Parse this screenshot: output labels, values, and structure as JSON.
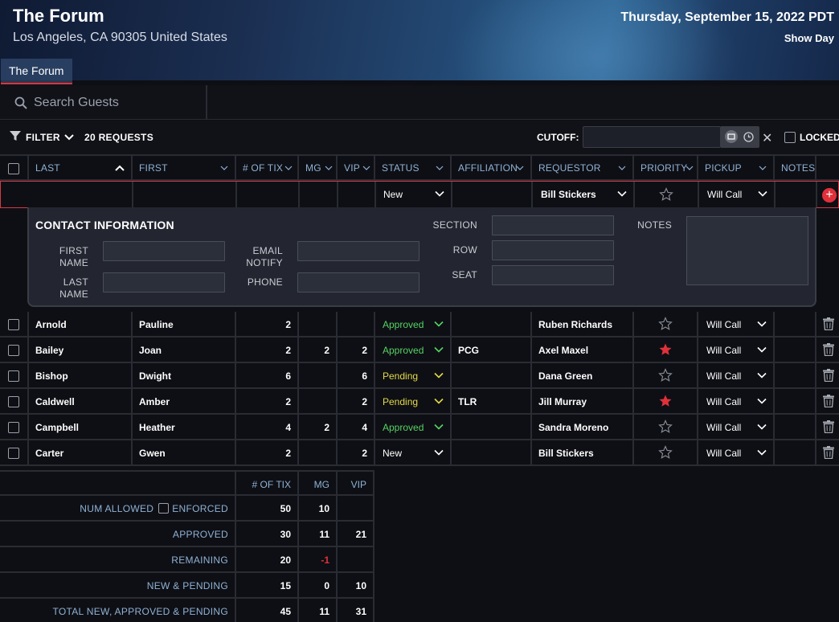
{
  "venue": {
    "title": "The Forum",
    "address": "Los Angeles, CA 90305 United States"
  },
  "show": {
    "date": "Thursday, September 15, 2022 PDT",
    "day": "Show Day"
  },
  "tabs": [
    {
      "label": "The Forum"
    }
  ],
  "search": {
    "placeholder": "Search Guests"
  },
  "filter": {
    "label": "FILTER",
    "count_label": "20 REQUESTS",
    "cutoff_label": "CUTOFF:",
    "locked_label": "LOCKED"
  },
  "columns": [
    "LAST",
    "FIRST",
    "# OF TIX",
    "MG",
    "VIP",
    "STATUS",
    "AFFILIATION",
    "REQUESTOR",
    "PRIORITY",
    "PICKUP",
    "NOTES"
  ],
  "new_row": {
    "status": "New",
    "requestor": "Bill Stickers",
    "pickup": "Will Call"
  },
  "contact": {
    "title": "CONTACT INFORMATION",
    "first_name_l1": "FIRST",
    "first_name_l2": "NAME",
    "last_name_l1": "LAST",
    "last_name_l2": "NAME",
    "email_l1": "EMAIL",
    "email_l2": "NOTIFY",
    "phone": "PHONE",
    "section": "SECTION",
    "row": "ROW",
    "seat": "SEAT",
    "notes": "NOTES"
  },
  "rows": [
    {
      "last": "Arnold",
      "first": "Pauline",
      "tix": "2",
      "mg": "",
      "vip": "",
      "status": "Approved",
      "affiliation": "",
      "requestor": "Ruben Richards",
      "priority": false,
      "pickup": "Will Call"
    },
    {
      "last": "Bailey",
      "first": "Joan",
      "tix": "2",
      "mg": "2",
      "vip": "2",
      "status": "Approved",
      "affiliation": "PCG",
      "requestor": "Axel Maxel",
      "priority": true,
      "pickup": "Will Call"
    },
    {
      "last": "Bishop",
      "first": "Dwight",
      "tix": "6",
      "mg": "",
      "vip": "6",
      "status": "Pending",
      "affiliation": "",
      "requestor": "Dana Green",
      "priority": false,
      "pickup": "Will Call"
    },
    {
      "last": "Caldwell",
      "first": "Amber",
      "tix": "2",
      "mg": "",
      "vip": "2",
      "status": "Pending",
      "affiliation": "TLR",
      "requestor": "Jill Murray",
      "priority": true,
      "pickup": "Will Call"
    },
    {
      "last": "Campbell",
      "first": "Heather",
      "tix": "4",
      "mg": "2",
      "vip": "4",
      "status": "Approved",
      "affiliation": "",
      "requestor": "Sandra Moreno",
      "priority": false,
      "pickup": "Will Call"
    },
    {
      "last": "Carter",
      "first": "Gwen",
      "tix": "2",
      "mg": "",
      "vip": "2",
      "status": "New",
      "affiliation": "",
      "requestor": "Bill Stickers",
      "priority": false,
      "pickup": "Will Call"
    }
  ],
  "totals": {
    "headers": {
      "tix": "# OF TIX",
      "mg": "MG",
      "vip": "VIP"
    },
    "enforced_label": "ENFORCED",
    "rows": [
      {
        "label": "NUM ALLOWED",
        "tix": "50",
        "mg": "10",
        "vip": ""
      },
      {
        "label": "APPROVED",
        "tix": "30",
        "mg": "11",
        "vip": "21"
      },
      {
        "label": "REMAINING",
        "tix": "20",
        "mg": "-1",
        "vip": ""
      },
      {
        "label": "NEW & PENDING",
        "tix": "15",
        "mg": "0",
        "vip": "10"
      },
      {
        "label": "TOTAL NEW, APPROVED & PENDING",
        "tix": "45",
        "mg": "11",
        "vip": "31"
      }
    ]
  },
  "colors": {
    "accent": "#e0313b",
    "approved": "#56d364",
    "pending": "#e3d94a",
    "header_text": "#8fb2d6"
  }
}
